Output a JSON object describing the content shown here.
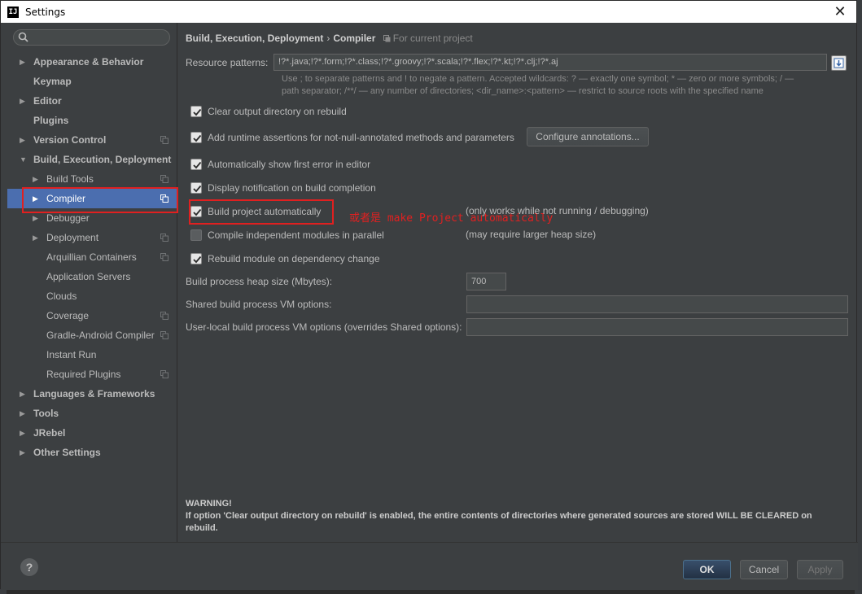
{
  "window": {
    "title": "Settings",
    "app_icon": "IJ",
    "close_glyph": "✕"
  },
  "search": {
    "placeholder": ""
  },
  "sidebar": {
    "items": [
      {
        "label": "Appearance & Behavior",
        "arrow": "▶",
        "bold": true
      },
      {
        "label": "Keymap",
        "arrow": "",
        "bold": true
      },
      {
        "label": "Editor",
        "arrow": "▶",
        "bold": true
      },
      {
        "label": "Plugins",
        "arrow": "",
        "bold": true
      },
      {
        "label": "Version Control",
        "arrow": "▶",
        "bold": true,
        "project": true
      },
      {
        "label": "Build, Execution, Deployment",
        "arrow": "▼",
        "bold": true
      },
      {
        "label": "Build Tools",
        "arrow": "▶",
        "project": true
      },
      {
        "label": "Compiler",
        "arrow": "▶",
        "project": true,
        "selected": true
      },
      {
        "label": "Debugger",
        "arrow": "▶"
      },
      {
        "label": "Deployment",
        "arrow": "▶",
        "project": true
      },
      {
        "label": "Arquillian Containers",
        "arrow": "",
        "project": true
      },
      {
        "label": "Application Servers",
        "arrow": ""
      },
      {
        "label": "Clouds",
        "arrow": ""
      },
      {
        "label": "Coverage",
        "arrow": "",
        "project": true
      },
      {
        "label": "Gradle-Android Compiler",
        "arrow": "",
        "project": true
      },
      {
        "label": "Instant Run",
        "arrow": ""
      },
      {
        "label": "Required Plugins",
        "arrow": "",
        "project": true
      },
      {
        "label": "Languages & Frameworks",
        "arrow": "▶",
        "bold": true
      },
      {
        "label": "Tools",
        "arrow": "▶",
        "bold": true
      },
      {
        "label": "JRebel",
        "arrow": "▶",
        "bold": true
      },
      {
        "label": "Other Settings",
        "arrow": "▶",
        "bold": true
      }
    ]
  },
  "breadcrumb": {
    "part1": "Build, Execution, Deployment",
    "separator": "›",
    "part2": "Compiler",
    "project_note": "For current project"
  },
  "resource_patterns": {
    "label": "Resource patterns:",
    "value": "!?*.java;!?*.form;!?*.class;!?*.groovy;!?*.scala;!?*.flex;!?*.kt;!?*.clj;!?*.aj",
    "hint_line1": "Use ; to separate patterns and ! to negate a pattern. Accepted wildcards: ? — exactly one symbol; * — zero or more symbols; / —",
    "hint_line2": "path separator; /**/ — any number of directories; <dir_name>:<pattern> — restrict to source roots with the specified name"
  },
  "checkboxes": {
    "clear_output": {
      "label": "Clear output directory on rebuild",
      "checked": true
    },
    "runtime_assertions": {
      "label": "Add runtime assertions for not-null-annotated methods and parameters",
      "checked": true
    },
    "show_first_error": {
      "label": "Automatically show first error in editor",
      "checked": true
    },
    "display_notification": {
      "label": "Display notification on build completion",
      "checked": true
    },
    "build_automatically": {
      "label": "Build project automatically",
      "checked": true,
      "note": "(only works while not running / debugging)"
    },
    "compile_parallel": {
      "label": "Compile independent modules in parallel",
      "checked": false,
      "note": "(may require larger heap size)"
    },
    "rebuild_on_dependency": {
      "label": "Rebuild module on dependency change",
      "checked": true
    }
  },
  "configure_annotations_button": "Configure annotations...",
  "annotation_text": "或者是 make Project automatically",
  "heap": {
    "label": "Build process heap size (Mbytes):",
    "value": "700"
  },
  "shared_vm": {
    "label": "Shared build process VM options:",
    "value": ""
  },
  "user_vm": {
    "label": "User-local build process VM options (overrides Shared options):",
    "value": ""
  },
  "warning": {
    "title": "WARNING!",
    "text": "If option 'Clear output directory on rebuild' is enabled, the entire contents of directories where generated sources are stored WILL BE CLEARED on rebuild."
  },
  "footer": {
    "help": "?",
    "ok": "OK",
    "cancel": "Cancel",
    "apply": "Apply"
  },
  "colors": {
    "selection": "#4b6eaf",
    "highlight_box": "#e02020",
    "background": "#3c3f41"
  }
}
